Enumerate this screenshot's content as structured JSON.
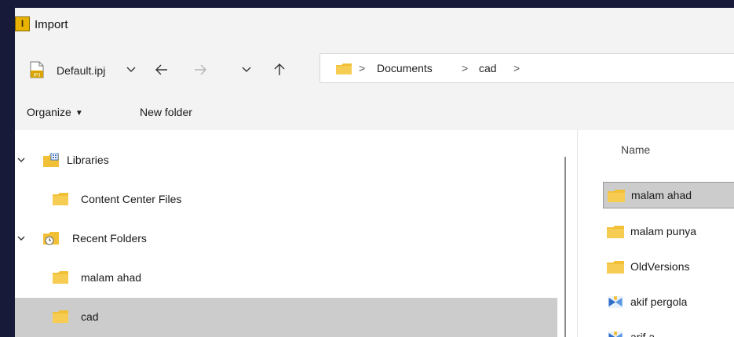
{
  "window": {
    "title": "Import",
    "app_icon_letter": "I"
  },
  "navbar": {
    "project_file": "Default.ipj",
    "file_icon_badge": "IPJ",
    "icons": {
      "dropdown": "chevron-down-icon",
      "back": "arrow-left-icon",
      "forward": "arrow-right-icon",
      "recent": "chevron-down-icon",
      "up": "arrow-up-icon"
    },
    "breadcrumb": [
      "Documents",
      "cad"
    ],
    "separator": ">"
  },
  "toolbar": {
    "organize_label": "Organize",
    "new_folder_label": "New folder"
  },
  "nav_tree": [
    {
      "label": "Libraries",
      "icon": "libraries-icon",
      "expanded": true
    },
    {
      "label": "Content Center Files",
      "icon": "folder-icon"
    },
    {
      "label": "Recent Folders",
      "icon": "recent-folders-icon",
      "expanded": true
    },
    {
      "label": "malam ahad",
      "icon": "folder-icon"
    },
    {
      "label": "cad",
      "icon": "folder-icon",
      "selected": true
    }
  ],
  "file_list": {
    "column_header": "Name",
    "items": [
      {
        "name": "malam ahad",
        "type": "folder",
        "selected": true
      },
      {
        "name": "malam punya",
        "type": "folder"
      },
      {
        "name": "OldVersions",
        "type": "folder"
      },
      {
        "name": "akif pergola",
        "type": "inventor-file"
      },
      {
        "name": "arif a",
        "type": "inventor-file"
      }
    ]
  },
  "colors": {
    "desktop_background": "#181a3a",
    "chrome_background": "#f3f3f3",
    "selection": "#cccccc",
    "folder_yellow": "#f2c037",
    "app_icon": "#e8b300"
  }
}
